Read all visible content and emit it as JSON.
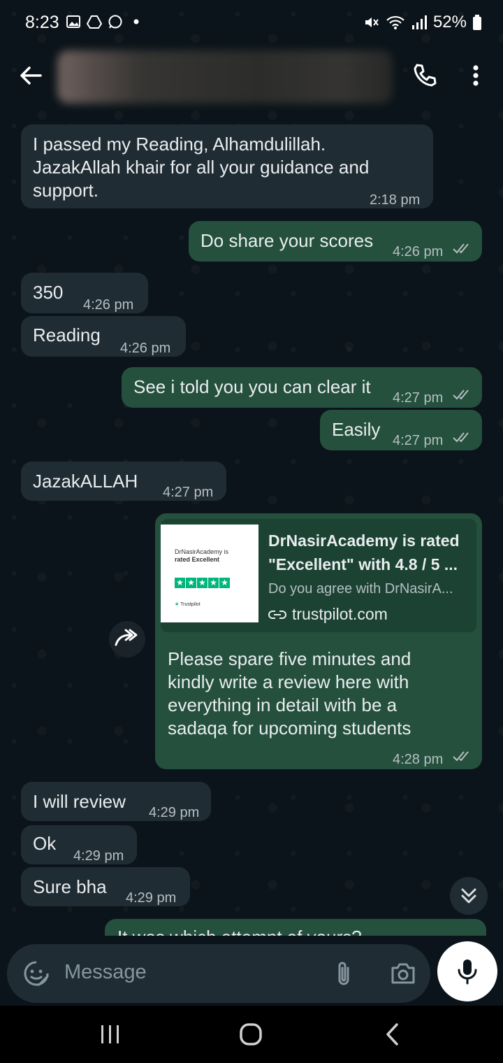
{
  "status_bar": {
    "time": "8:23",
    "battery": "52%"
  },
  "header": {
    "contact_name": ""
  },
  "messages": [
    {
      "text_lines": [
        "I passed my Reading, Alhamdulillah.",
        "JazakAllah khair for all your guidance and",
        "support."
      ],
      "time": "2:18 pm"
    },
    {
      "text": "Do share your scores",
      "time": "4:26 pm"
    },
    {
      "text": "350",
      "time": "4:26 pm"
    },
    {
      "text": "Reading",
      "time": "4:26 pm"
    },
    {
      "text": "See i told you you can clear it",
      "time": "4:27 pm"
    },
    {
      "text": "Easily",
      "time": "4:27 pm"
    },
    {
      "text": "JazakALLAH",
      "time": "4:27 pm"
    },
    {
      "link_preview": {
        "title_lines": [
          "DrNasirAcademy is rated",
          "\"Excellent\" with 4.8 / 5 ..."
        ],
        "description": "Do you agree with DrNasirA...",
        "domain": "trustpilot.com",
        "thumb_brand_lines": [
          "DrNasirAcademy is",
          "rated Excellent"
        ],
        "thumb_logo": "Trustpilot"
      },
      "text_lines": [
        "Please spare five minutes and",
        "kindly write a review here with",
        "everything in detail with be a",
        "sadaqa for upcoming students"
      ],
      "time": "4:28 pm"
    },
    {
      "text": "I will review",
      "time": "4:29 pm"
    },
    {
      "text": "Ok",
      "time": "4:29 pm"
    },
    {
      "text": "Sure bha",
      "time": "4:29 pm"
    },
    {
      "text": "It was which attempt of yours?"
    }
  ],
  "input": {
    "placeholder": "Message"
  },
  "colors": {
    "incoming": "#202c33",
    "outgoing": "#24503d",
    "accent_check": "#b7bfc3"
  }
}
